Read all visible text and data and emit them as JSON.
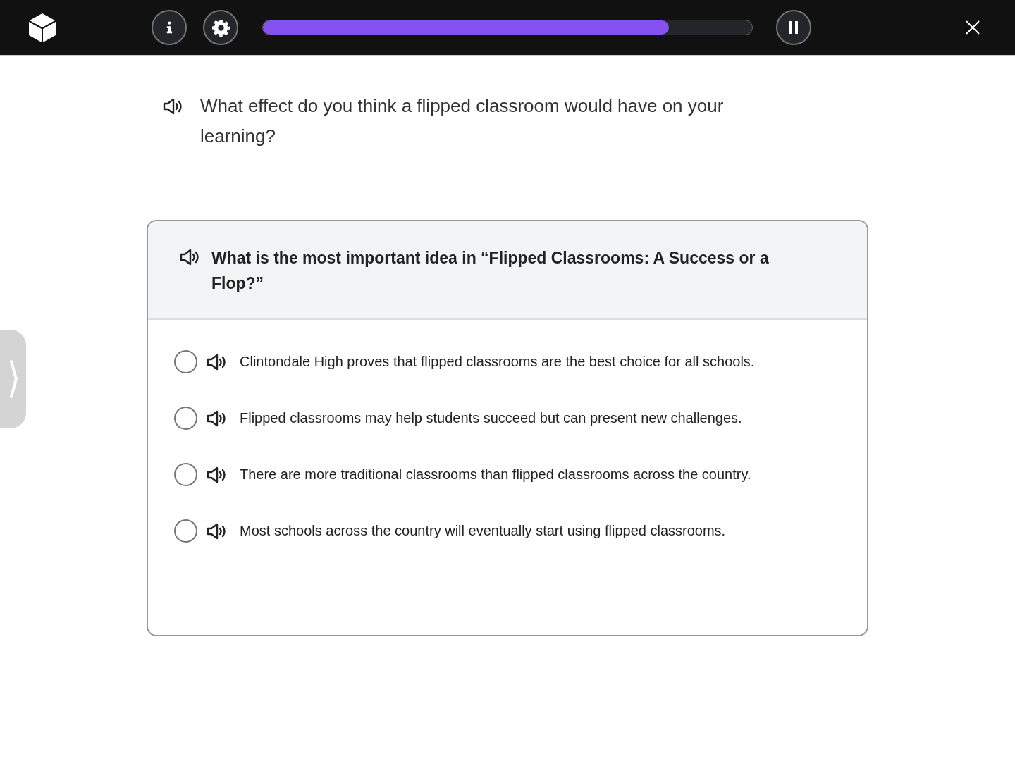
{
  "toolbar": {
    "progress": {
      "level": 0.83
    }
  },
  "prompt": {
    "text": "What effect do you think a flipped classroom would have on your learning?"
  },
  "question": {
    "text": "What is the most important idea in “Flipped Classrooms: A Success or a Flop?”",
    "options": [
      {
        "text": "Clintondale High proves that flipped classrooms are the best choice for all schools.",
        "selected": false
      },
      {
        "text": "Flipped classrooms may help students succeed but can present new challenges.",
        "selected": false
      },
      {
        "text": "There are more traditional classrooms than flipped classrooms across the country.",
        "selected": false
      },
      {
        "text": "Most schools across the country will eventually start using flipped classrooms.",
        "selected": false
      }
    ]
  }
}
